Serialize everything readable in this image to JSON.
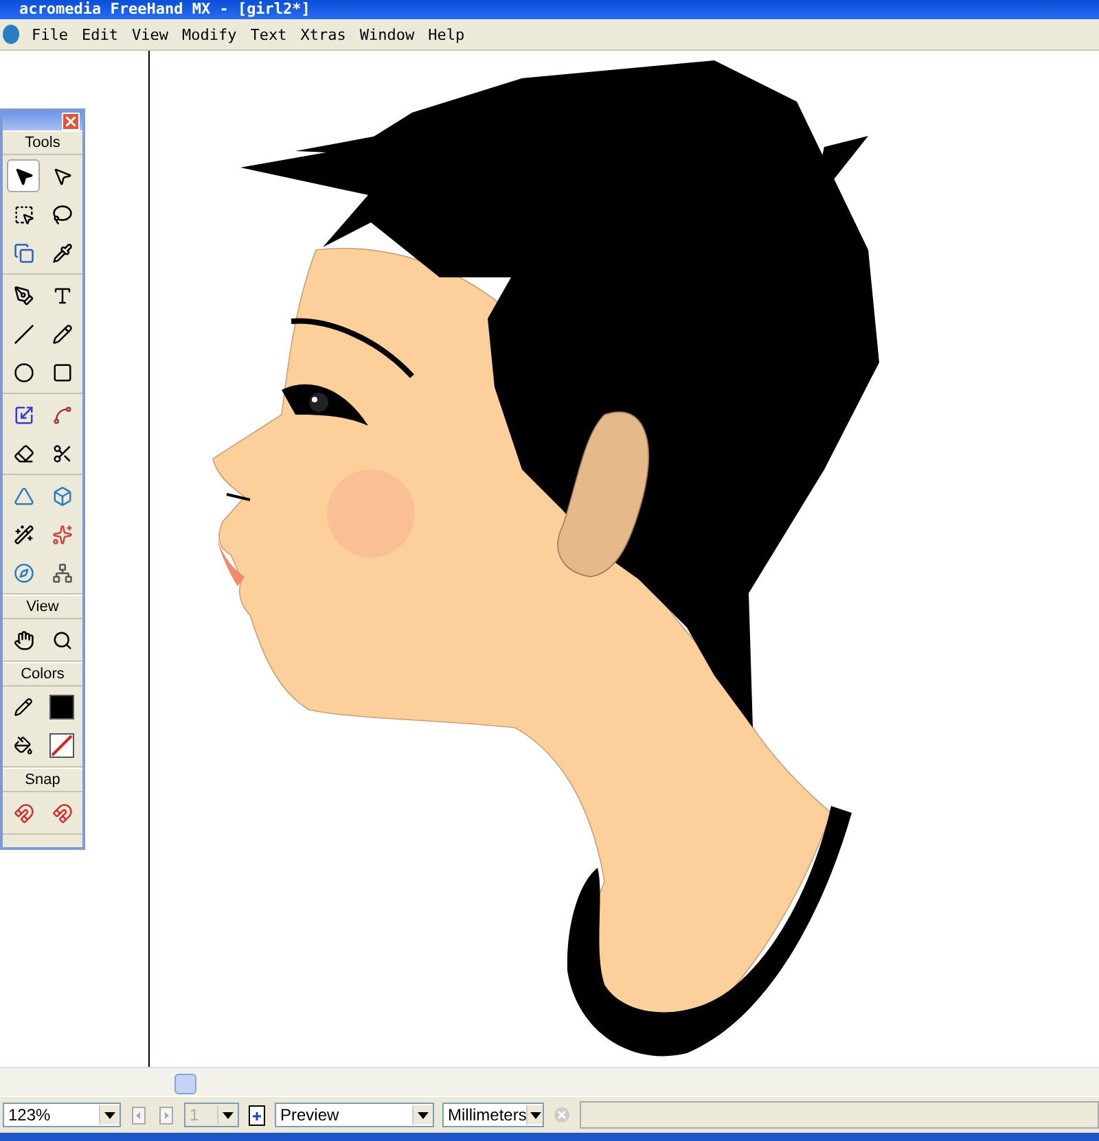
{
  "window": {
    "title": "acromedia FreeHand MX - [girl2*]"
  },
  "menu": [
    "File",
    "Edit",
    "View",
    "Modify",
    "Text",
    "Xtras",
    "Window",
    "Help"
  ],
  "toolbox": {
    "sections": [
      {
        "title": "Tools",
        "groups": [
          [
            {
              "selected": true
            },
            {
              "selected": false
            },
            {
              "selected": false
            },
            {
              "selected": false
            },
            {
              "selected": false
            },
            {
              "selected": false
            }
          ],
          [
            {
              "selected": false
            },
            {
              "selected": false
            },
            {
              "selected": false
            },
            {
              "selected": false
            },
            {
              "selected": false
            },
            {
              "selected": false
            }
          ],
          [
            {
              "selected": false
            },
            {
              "selected": false
            },
            {
              "selected": false
            },
            {
              "selected": false
            }
          ],
          [
            {
              "selected": false
            },
            {
              "selected": false
            },
            {
              "selected": false
            },
            {
              "selected": false
            },
            {
              "selected": false
            },
            {
              "selected": false
            }
          ]
        ]
      },
      {
        "title": "View",
        "groups": [
          [
            {
              "selected": false
            },
            {
              "selected": false
            }
          ]
        ]
      },
      {
        "title": "Colors",
        "groups": [
          [
            {
              "selected": false
            },
            {
              "selected": false
            },
            {
              "selected": false
            },
            {
              "selected": false
            }
          ]
        ]
      },
      {
        "title": "Snap",
        "groups": [
          [
            {
              "selected": false
            },
            {
              "selected": false
            }
          ]
        ]
      }
    ]
  },
  "status_bar": {
    "zoom": "123%",
    "page": "1",
    "page_disabled": true,
    "view_mode": "Preview",
    "units": "Millimeters"
  }
}
